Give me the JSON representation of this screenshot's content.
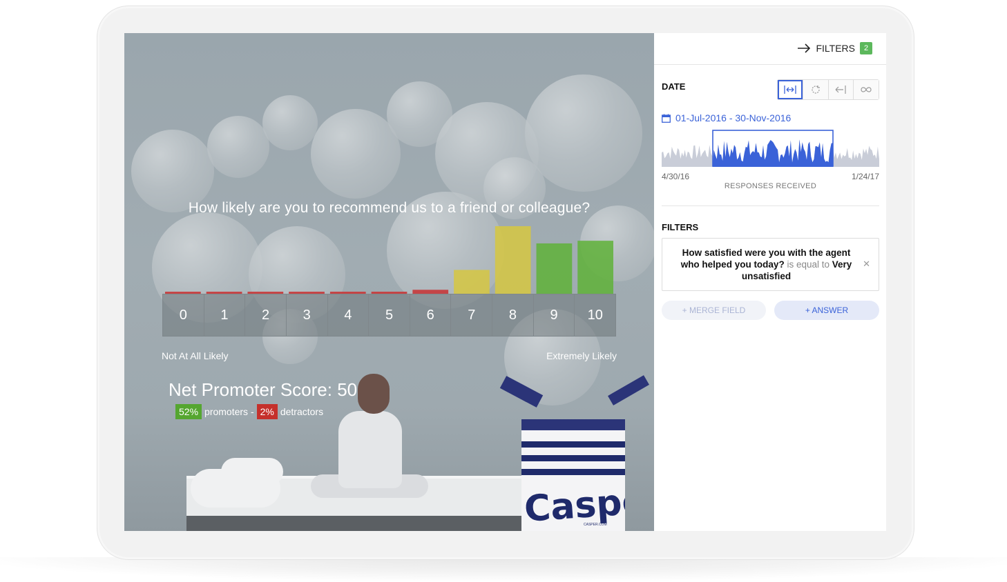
{
  "survey": {
    "question": "How likely are you to recommend us to a friend or colleague?",
    "scale": [
      "0",
      "1",
      "2",
      "3",
      "4",
      "5",
      "6",
      "7",
      "8",
      "9",
      "10"
    ],
    "response_share": [
      0.01,
      0.01,
      0.01,
      0.01,
      0.01,
      0.01,
      0.03,
      0.18,
      0.51,
      0.38,
      0.4
    ],
    "low_label": "Not At All Likely",
    "high_label": "Extremely Likely",
    "nps_title": "Net Promoter Score: 50",
    "promoters_pct": "52%",
    "promoters_label": "promoters -",
    "detractors_pct": "2%",
    "detractors_label": "detractors",
    "brand": "Casper",
    "brand_sub": "CASPER.COM"
  },
  "colors": {
    "detractor": "#c7383a",
    "passive": "#d6c741",
    "promoter": "#5fb238",
    "accent": "#3a62d8",
    "badge": "#5cb85c"
  },
  "panel": {
    "toggle_label": "FILTERS",
    "filter_count": "2",
    "date_label": "DATE",
    "range_buttons": [
      {
        "icon": "fit-range-icon",
        "active": true
      },
      {
        "icon": "refresh-icon",
        "active": false
      },
      {
        "icon": "back-arrow-icon",
        "active": false
      },
      {
        "icon": "infinity-icon",
        "active": false
      }
    ],
    "date_range": "01-Jul-2016 - 30-Nov-2016",
    "timeline_start": "4/30/16",
    "timeline_end": "1/24/17",
    "timeline_caption": "RESPONSES RECEIVED",
    "filters_label": "FILTERS",
    "filter_question": "How satisfied were you with the agent who helped you today?",
    "filter_operator": "is equal to",
    "filter_value_a": "Very",
    "filter_value_b": "unsatisfied",
    "merge_button": "+ MERGE FIELD",
    "answer_button": "+ ANSWER"
  }
}
